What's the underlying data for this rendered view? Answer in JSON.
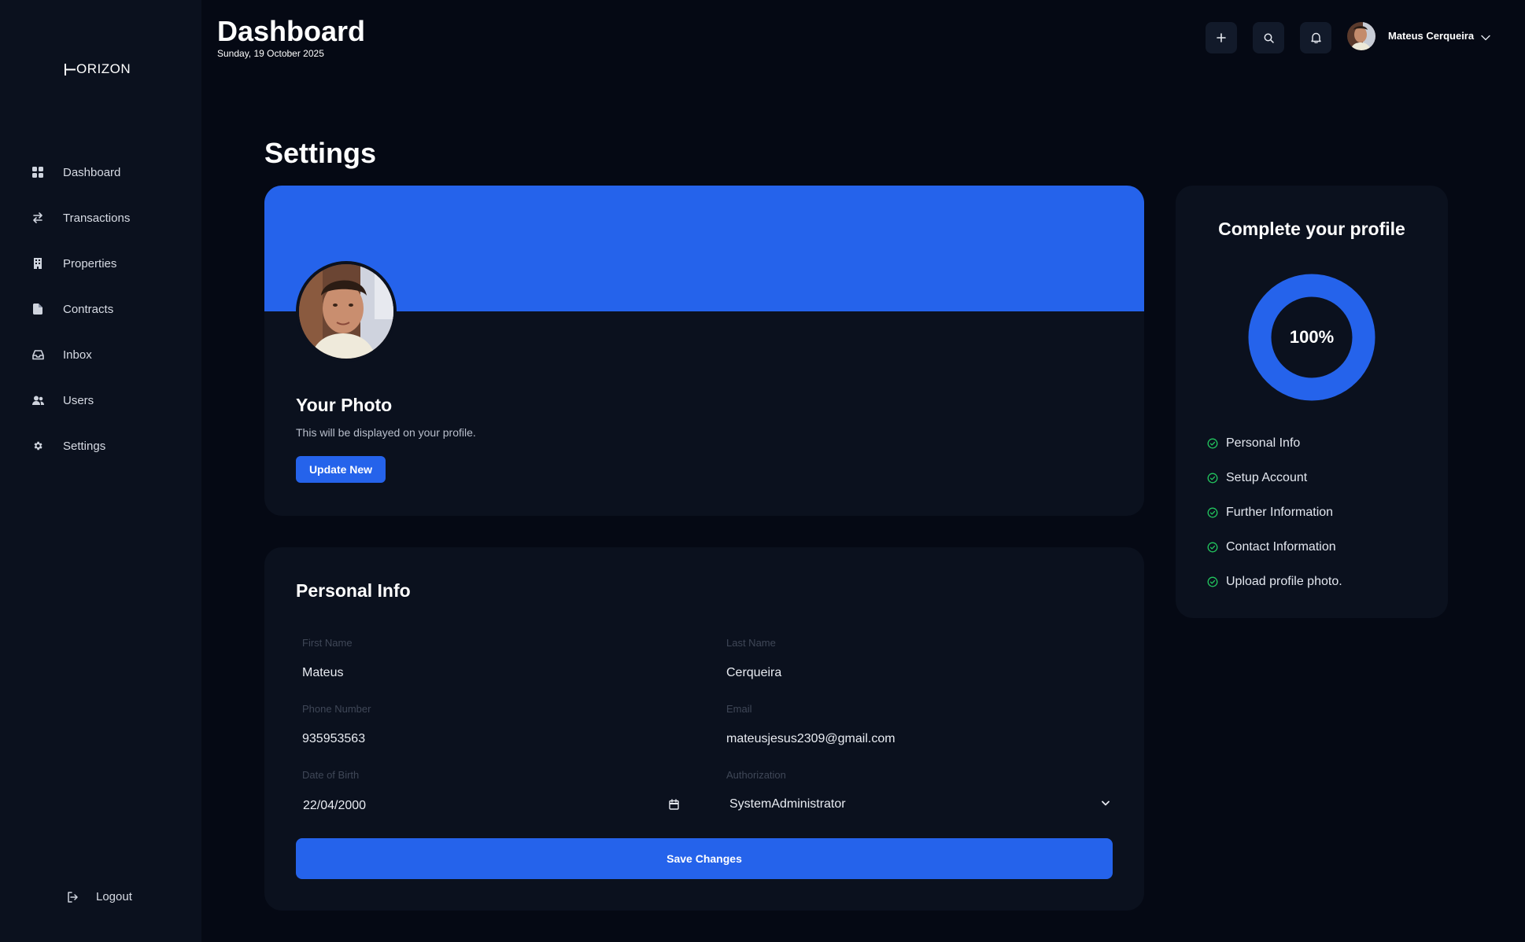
{
  "brand": {
    "logo_text": "ORIZON",
    "logo_initial_icon": "h-bar-icon"
  },
  "sidebar": {
    "items": [
      {
        "label": "Dashboard",
        "icon": "grid-icon"
      },
      {
        "label": "Transactions",
        "icon": "arrows-exchange-icon"
      },
      {
        "label": "Properties",
        "icon": "building-icon"
      },
      {
        "label": "Contracts",
        "icon": "document-icon"
      },
      {
        "label": "Inbox",
        "icon": "inbox-icon"
      },
      {
        "label": "Users",
        "icon": "users-icon"
      },
      {
        "label": "Settings",
        "icon": "gear-icon"
      }
    ],
    "logout_label": "Logout"
  },
  "header": {
    "title": "Dashboard",
    "date": "Sunday, 19 October 2025",
    "user_name": "Mateus Cerqueira"
  },
  "settings": {
    "title": "Settings",
    "photo": {
      "title": "Your Photo",
      "description": "This will be displayed on your profile.",
      "update_label": "Update New"
    },
    "personal_info": {
      "title": "Personal Info",
      "first_name_label": "First Name",
      "first_name": "Mateus",
      "last_name_label": "Last Name",
      "last_name": "Cerqueira",
      "phone_label": "Phone Number",
      "phone": "935953563",
      "email_label": "Email",
      "email": "mateusjesus2309@gmail.com",
      "dob_label": "Date of Birth",
      "dob": "22/04/2000",
      "authorization_label": "Authorization",
      "authorization": "SystemAdministrator",
      "save_label": "Save Changes"
    },
    "profile_completion": {
      "title": "Complete your profile",
      "percent_label": "100%",
      "percent": 1.0,
      "checklist": [
        "Personal Info",
        "Setup Account",
        "Further Information",
        "Contact Information",
        "Upload profile photo."
      ]
    }
  },
  "colors": {
    "accent": "#2563eb",
    "background": "#050914",
    "card": "#0b111e",
    "check": "#22c55e"
  }
}
